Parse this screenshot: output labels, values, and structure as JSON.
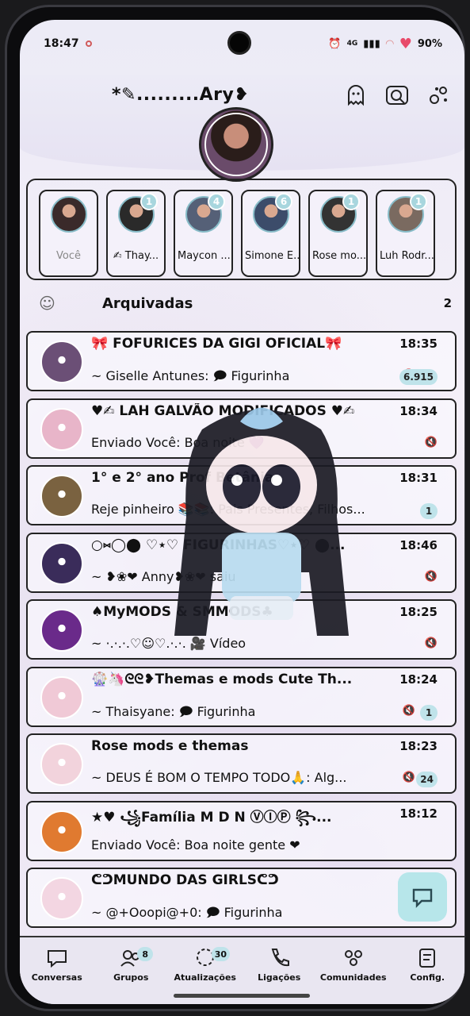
{
  "status_bar": {
    "time": "18:47",
    "network": "4G",
    "battery": "90%"
  },
  "header": {
    "title": "*✎.........Ary❥",
    "icons": [
      "ghost-icon",
      "camera-search-icon",
      "settings-flowers-icon"
    ]
  },
  "stories": [
    {
      "name": "Você",
      "badge": "",
      "me": true,
      "color": "#3a2a2a"
    },
    {
      "name": "✍ Thay...",
      "badge": "1",
      "me": false,
      "color": "#2a2a2a"
    },
    {
      "name": "Maycon ...",
      "badge": "4",
      "me": false,
      "color": "#556077"
    },
    {
      "name": "Simone E...",
      "badge": "6",
      "me": false,
      "color": "#3c4c6a"
    },
    {
      "name": "Rose mo...",
      "badge": "1",
      "me": false,
      "color": "#333"
    },
    {
      "name": "Luh Rodr...",
      "badge": "1",
      "me": false,
      "color": "#7a6a60"
    }
  ],
  "archived": {
    "label": "Arquivadas",
    "count": "2"
  },
  "chats": [
    {
      "name": "🎀 FOFURICES DA GIGI OFICIAL🎀",
      "time": "18:35",
      "message": "~ Giselle Antunes: 🗩 Figurinha",
      "unread": "6.915",
      "muted": true,
      "color": "#6b4f76"
    },
    {
      "name": "♥✍ LAH GALVÃO MODIFICADOS ♥✍",
      "time": "18:34",
      "message": "Enviado Você: Boa noite 💜",
      "unread": "",
      "muted": true,
      "color": "#e8b5c9"
    },
    {
      "name": "1° e 2° ano Prof Betânia",
      "time": "18:31",
      "message": "Reje pinheiro 📚📚: Pais Presentes, Filhos...",
      "unread": "1",
      "muted": false,
      "color": "#7a6240"
    },
    {
      "name": "○⑅◯⬤ ♡⋆♡ FIGURINHAS♡⋆♡ ⬤...",
      "time": "18:46",
      "message": "~ ❥❀❤ Anny❥❀❤ saiu",
      "unread": "",
      "muted": true,
      "color": "#3a2c5a"
    },
    {
      "name": "♠MyMODS & SMMODS♣",
      "time": "18:25",
      "message": "~ ·.·.·.♡☺♡.·.·. 🎥 Vídeo",
      "unread": "",
      "muted": true,
      "color": "#6a2a8a"
    },
    {
      "name": "🎡🦄ᘓᘓ❥Themas e mods Cute Th...",
      "time": "18:24",
      "message": "~ Thaisyane: 🗩 Figurinha",
      "unread": "1",
      "muted": true,
      "color": "#f0c9d6"
    },
    {
      "name": "Rose mods e themas",
      "time": "18:23",
      "message": "~ DEUS É BOM O TEMPO TODO🙏: Alg...",
      "unread": "24",
      "muted": true,
      "color": "#f2d3dc"
    },
    {
      "name": "★♥ ꧁Família M D N ⓋⒾⓅ ꧂...",
      "time": "18:12",
      "message": "Enviado Você: Boa noite gente ❤",
      "unread": "",
      "muted": false,
      "color": "#e07a30"
    },
    {
      "name": "ᕦᕤMUNDO DAS GIRLSᕦᕤ",
      "time": "",
      "message": "~ @+Ooopi@+0: 🗩 Figurinha",
      "unread": "",
      "muted": false,
      "color": "#f3d6e2"
    }
  ],
  "nav": [
    {
      "label": "Conversas",
      "icon": "chat-bubble-icon",
      "badge": ""
    },
    {
      "label": "Grupos",
      "icon": "groups-icon",
      "badge": "8"
    },
    {
      "label": "Atualizações",
      "icon": "updates-icon",
      "badge": "30"
    },
    {
      "label": "Ligações",
      "icon": "phone-icon",
      "badge": ""
    },
    {
      "label": "Comunidades",
      "icon": "communities-icon",
      "badge": ""
    },
    {
      "label": "Config.",
      "icon": "settings-icon",
      "badge": ""
    }
  ]
}
